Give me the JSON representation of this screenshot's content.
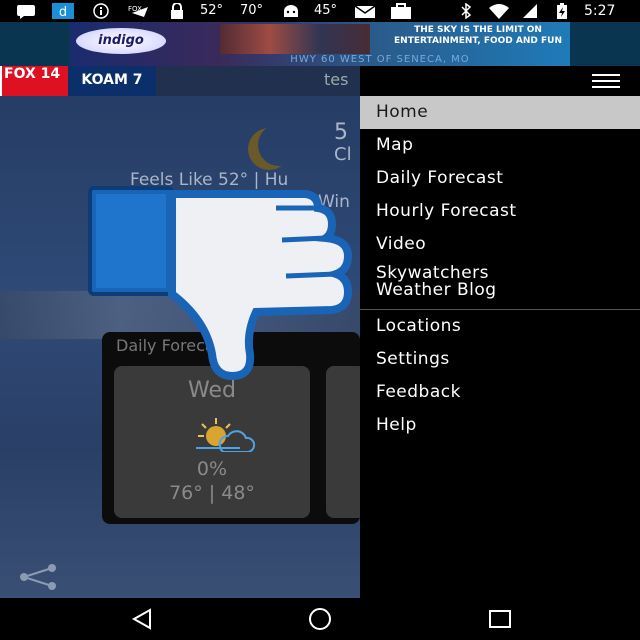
{
  "statusbar": {
    "temp1": "52°",
    "temp2": "70°",
    "temp3": "45°",
    "time": "5:27",
    "icons": [
      "message-icon",
      "d-app-icon",
      "info-icon",
      "fox-icon",
      "lock-icon",
      "weather-icon",
      "android-icon",
      "mail-icon",
      "briefcase-icon",
      "bluetooth-icon",
      "wifi-icon",
      "signal-icon",
      "battery-icon"
    ]
  },
  "ad": {
    "logo": "indigo",
    "headline": "THE SKY IS THE LIMIT ON ENTERTAINMENT, FOOD AND FUN",
    "sub": "HWY 60 WEST OF SENECA, MO"
  },
  "header": {
    "brand_fox": "FOX 14",
    "brand_cbs": "KOAM 7",
    "search_text": "tes"
  },
  "current": {
    "temp": "5",
    "condition": "Cl",
    "feels_like": "Feels Like  52° | Hu",
    "wind": "Win"
  },
  "daily": {
    "title": "Daily Forecast",
    "cards": [
      {
        "day": "Wed",
        "precip": "0%",
        "range": "76° | 48°"
      }
    ]
  },
  "drawer": {
    "items": [
      {
        "label": "Home",
        "active": true
      },
      {
        "label": "Map"
      },
      {
        "label": "Daily Forecast"
      },
      {
        "label": "Hourly Forecast"
      },
      {
        "label": "Video"
      },
      {
        "label": "Skywatchers"
      },
      {
        "label": "Weather Blog"
      },
      {
        "label": "Locations"
      },
      {
        "label": "Settings"
      },
      {
        "label": "Feedback"
      },
      {
        "label": "Help"
      }
    ]
  },
  "colors": {
    "drawer_active": "#c8c8c8",
    "thumb_blue": "#1a64b8",
    "main_bg": "#2f4a78"
  }
}
